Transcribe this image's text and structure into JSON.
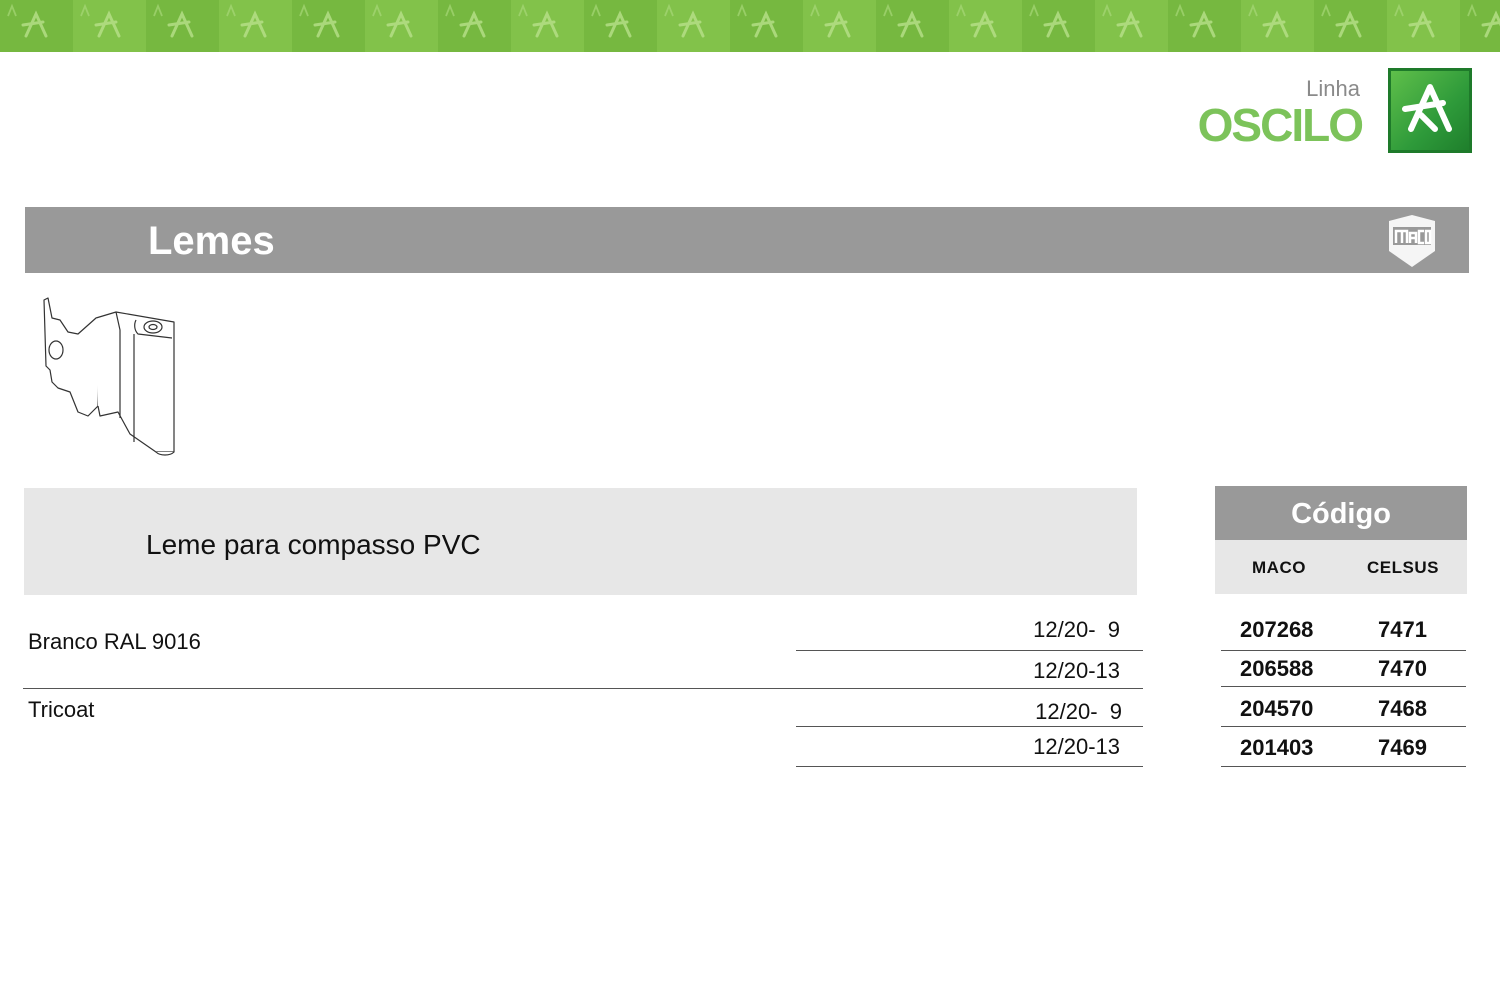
{
  "brand": {
    "line_label": "Linha",
    "name": "OSCILO",
    "colors": {
      "green": "#7cc35a",
      "logo_green": "#2e9a3a"
    }
  },
  "header": {
    "title": "Lemes",
    "band_color": "#999999",
    "maco_logo_icon": "maco-logo-icon"
  },
  "product": {
    "drawing_icon": "hinge-drawing-icon",
    "description": "Leme para compasso PVC"
  },
  "code_table": {
    "title": "Código",
    "columns": [
      "MACO",
      "CELSUS"
    ]
  },
  "variants": [
    {
      "name": "Branco RAL 9016",
      "rows": [
        {
          "size": "12/20-  9",
          "maco": "207268",
          "celsus": "7471"
        },
        {
          "size": "12/20-13",
          "maco": "206588",
          "celsus": "7470"
        }
      ]
    },
    {
      "name": "Tricoat",
      "rows": [
        {
          "size": "12/20-  9",
          "maco": "204570",
          "celsus": "7468"
        },
        {
          "size": "12/20-13",
          "maco": "201403",
          "celsus": "7469"
        }
      ]
    }
  ]
}
